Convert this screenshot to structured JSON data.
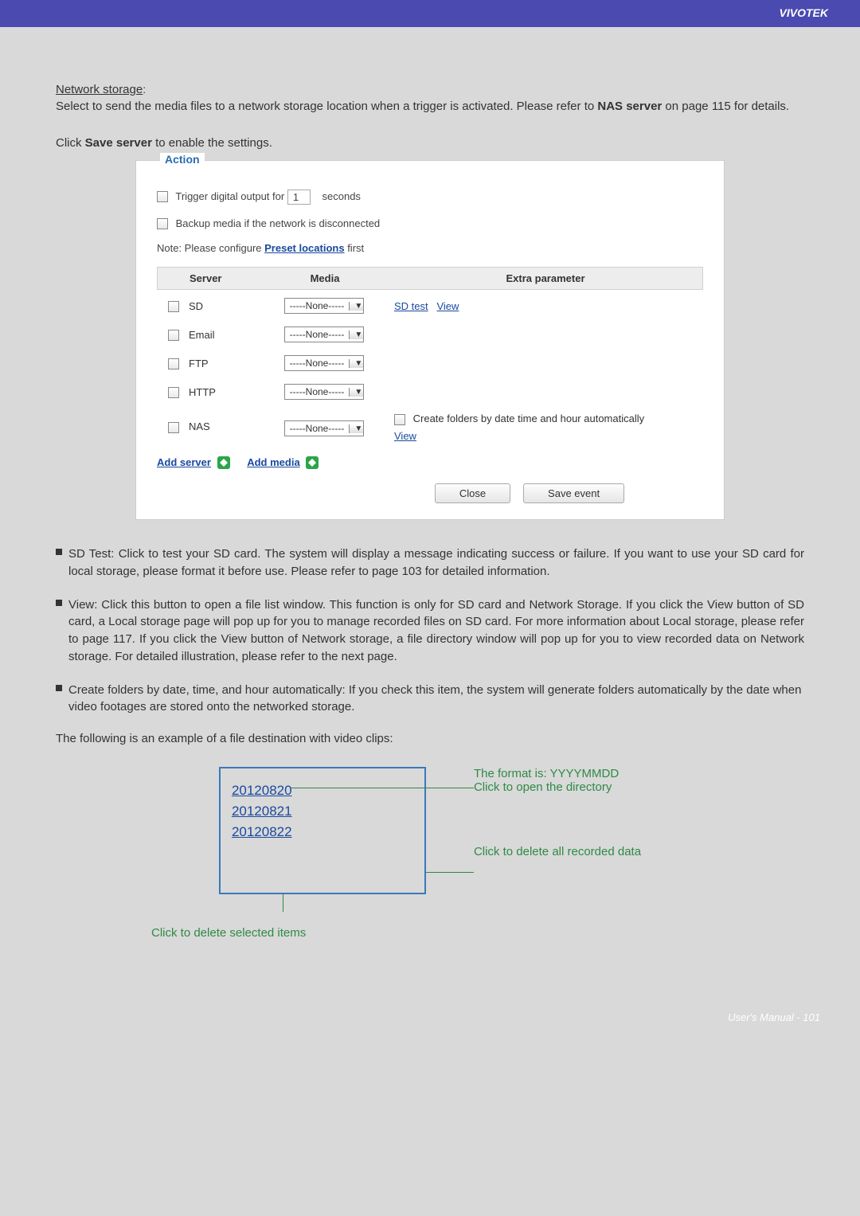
{
  "brand": "VIVOTEK",
  "intro": {
    "heading": "Network storage",
    "colon": ":",
    "p1a": "Select to send the media files to a network storage location when a trigger is activated. Please refer to ",
    "p1b": "NAS server",
    "p1c": " on page 115 for details.",
    "p2a": "Click ",
    "p2b": "Save server",
    "p2c": " to enable the settings."
  },
  "panel": {
    "legend": "Action",
    "triggerLabelA": "Trigger digital output for",
    "triggerValue": "1",
    "triggerLabelB": "seconds",
    "backupLabel": "Backup media if the network is disconnected",
    "noteA": "Note: Please configure ",
    "noteLink": "Preset locations",
    "noteB": " first",
    "head": {
      "server": "Server",
      "media": "Media",
      "extra": "Extra parameter"
    },
    "rows": {
      "sd": {
        "name": "SD",
        "media": "-----None-----",
        "link1": "SD test",
        "link2": "View"
      },
      "email": {
        "name": "Email",
        "media": "-----None-----"
      },
      "ftp": {
        "name": "FTP",
        "media": "-----None-----"
      },
      "http": {
        "name": "HTTP",
        "media": "-----None-----"
      },
      "nas": {
        "name": "NAS",
        "media": "-----None-----",
        "extra": "Create folders by date time and hour automatically",
        "link": "View"
      }
    },
    "addServer": "Add server",
    "addMedia": "Add media",
    "close": "Close",
    "save": "Save event"
  },
  "bullets": {
    "b1": "SD Test: Click to test your SD card. The system will display a message indicating success or failure. If you want to use your SD card for local storage, please format it before use. Please refer to page 103 for detailed information.",
    "b2": "View: Click this button to open a file list window. This function is only for SD card and Network Storage. If you click the View button of SD card, a Local storage page will pop up for you to manage recorded files on SD card. For more information about Local storage, please refer to page 117. If you click the View button of Network storage, a file directory window will pop up for you to view recorded data on Network storage. For detailed illustration, please refer to the next page.",
    "b3": "Create folders by date, time, and hour automatically: If you check this item, the system will generate folders automatically by the date when video footages are stored onto the networked storage."
  },
  "exampleIntro": "The following is an example of a file destination with video clips:",
  "diagram": {
    "d1": "20120820",
    "d2": "20120821",
    "d3": "20120822",
    "c1a": "The format is: YYYYMMDD",
    "c1b": "Click to open the directory",
    "c2": "Click to delete all recorded data",
    "c3": "Click to delete selected items"
  },
  "footer": "User's Manual - 101"
}
